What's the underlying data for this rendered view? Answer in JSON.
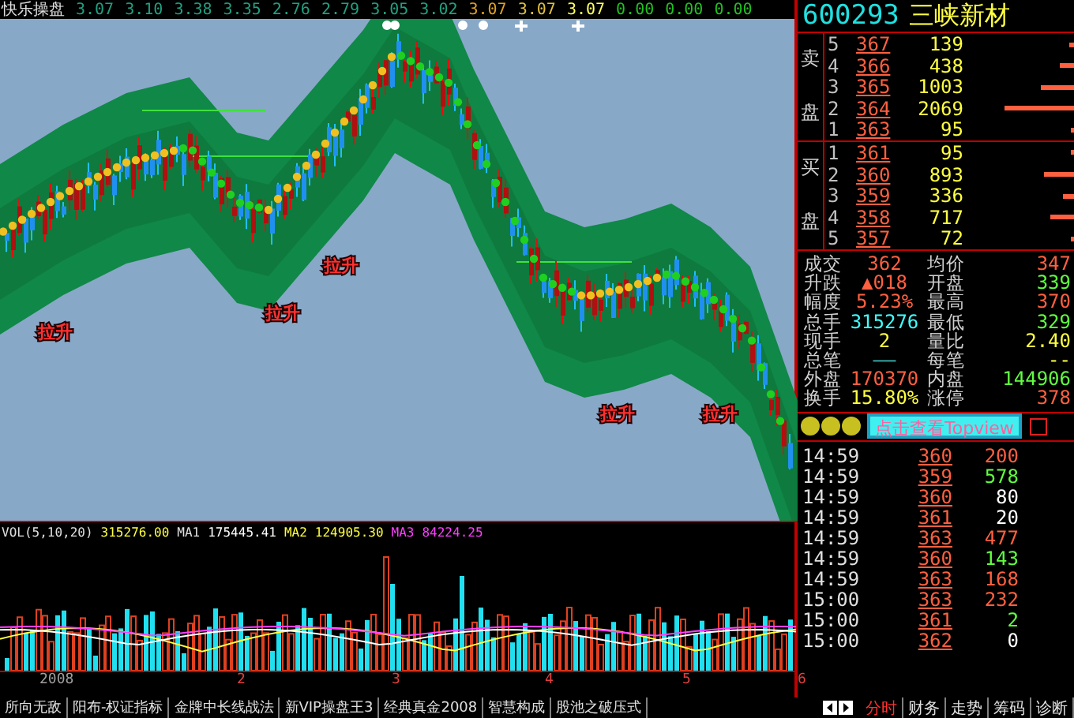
{
  "title": "快乐操盘",
  "quote_strip": [
    {
      "text": "3.07",
      "color": "#20a080"
    },
    {
      "text": "3.10",
      "color": "#20a080"
    },
    {
      "text": "3.38",
      "color": "#20a080"
    },
    {
      "text": "3.35",
      "color": "#20a080"
    },
    {
      "text": "2.76",
      "color": "#20a080"
    },
    {
      "text": "2.79",
      "color": "#20a080"
    },
    {
      "text": "3.05",
      "color": "#20a080"
    },
    {
      "text": "3.02",
      "color": "#20a080"
    },
    {
      "text": "3.07",
      "color": "#e0a020"
    },
    {
      "text": "3.07",
      "color": "#e0c040"
    },
    {
      "text": "3.07",
      "color": "#ffff60"
    },
    {
      "text": "0.00",
      "color": "#20c020"
    },
    {
      "text": "0.00",
      "color": "#20c020"
    },
    {
      "text": "0.00",
      "color": "#20c020"
    }
  ],
  "chart": {
    "annotations": [
      "拉升",
      "拉升",
      "拉升",
      "拉升",
      "拉升"
    ]
  },
  "volume_legend": [
    {
      "text": "VOL(5,10,20)",
      "color": "#e0e0e0"
    },
    {
      "text": "315276.00",
      "color": "#ffff40"
    },
    {
      "text": "MA1",
      "color": "#e0e0e0"
    },
    {
      "text": "175445.41",
      "color": "#ffffff"
    },
    {
      "text": "MA2",
      "color": "#ffff40"
    },
    {
      "text": "124905.30",
      "color": "#ffff40"
    },
    {
      "text": "MA3",
      "color": "#ff40ff"
    },
    {
      "text": "84224.25",
      "color": "#ff40ff"
    }
  ],
  "x_axis": [
    "2008",
    "2",
    "3",
    "4",
    "5",
    "6"
  ],
  "indicator_tabs": [
    {
      "label": "所向无敌",
      "selected": false
    },
    {
      "label": "阳布-权证指标",
      "selected": false
    },
    {
      "label": "金牌中长线战法",
      "selected": false
    },
    {
      "label": "新VIP操盘王3",
      "selected": false
    },
    {
      "label": "经典真金2008",
      "selected": false
    },
    {
      "label": "智慧构成",
      "selected": false
    },
    {
      "label": "股池之破压式",
      "selected": false
    }
  ],
  "view_tabs": [
    {
      "label": "分时",
      "selected": true
    },
    {
      "label": "财务",
      "selected": false
    },
    {
      "label": "走势",
      "selected": false
    },
    {
      "label": "筹码",
      "selected": false
    },
    {
      "label": "诊断",
      "selected": false
    }
  ],
  "quote": {
    "code": "600293",
    "name": "三峡新材",
    "sell_label": [
      "卖",
      "盘"
    ],
    "sell": [
      {
        "level": "5",
        "price": "367",
        "volume": "139"
      },
      {
        "level": "4",
        "price": "366",
        "volume": "438"
      },
      {
        "level": "3",
        "price": "365",
        "volume": "1003"
      },
      {
        "level": "2",
        "price": "364",
        "volume": "2069"
      },
      {
        "level": "1",
        "price": "363",
        "volume": "95"
      }
    ],
    "buy_label": [
      "买",
      "盘"
    ],
    "buy": [
      {
        "level": "1",
        "price": "361",
        "volume": "95"
      },
      {
        "level": "2",
        "price": "360",
        "volume": "893"
      },
      {
        "level": "3",
        "price": "359",
        "volume": "336"
      },
      {
        "level": "4",
        "price": "358",
        "volume": "717"
      },
      {
        "level": "5",
        "price": "357",
        "volume": "72"
      }
    ],
    "stats": [
      {
        "label": "成交",
        "value": "362",
        "color": "#ff6040"
      },
      {
        "label": "均价",
        "value": "347",
        "color": "#ff6040"
      },
      {
        "label": "升跌",
        "value": "▲018",
        "color": "#ff6040"
      },
      {
        "label": "开盘",
        "value": "339",
        "color": "#60ff40"
      },
      {
        "label": "幅度",
        "value": "5.23%",
        "color": "#ff6040"
      },
      {
        "label": "最高",
        "value": "370",
        "color": "#ff6040"
      },
      {
        "label": "总手",
        "value": "315276",
        "color": "#40ffff"
      },
      {
        "label": "最低",
        "value": "329",
        "color": "#60ff40"
      },
      {
        "label": "现手",
        "value": "2",
        "color": "#ffff40"
      },
      {
        "label": "量比",
        "value": "2.40",
        "color": "#ffff40"
      },
      {
        "label": "总笔",
        "value": "——",
        "color": "#40c0c0"
      },
      {
        "label": "每笔",
        "value": "--",
        "color": "#ffff40"
      },
      {
        "label": "外盘",
        "value": "170370",
        "color": "#ff6040"
      },
      {
        "label": "内盘",
        "value": "144906",
        "color": "#60ff40"
      },
      {
        "label": "换手",
        "value": "15.80%",
        "color": "#ffff40"
      },
      {
        "label": "涨停",
        "value": "378",
        "color": "#ff6040"
      }
    ],
    "topview_button": "点击查看Topview",
    "ticks": [
      {
        "time": "14:59",
        "price": "360",
        "volume": "200",
        "color": "#ff6040"
      },
      {
        "time": "14:59",
        "price": "359",
        "volume": "578",
        "color": "#60ff40"
      },
      {
        "time": "14:59",
        "price": "360",
        "volume": "80",
        "color": "#ffffff"
      },
      {
        "time": "14:59",
        "price": "361",
        "volume": "20",
        "color": "#ffffff"
      },
      {
        "time": "14:59",
        "price": "363",
        "volume": "477",
        "color": "#ff6040"
      },
      {
        "time": "14:59",
        "price": "360",
        "volume": "143",
        "color": "#60ff40"
      },
      {
        "time": "14:59",
        "price": "363",
        "volume": "168",
        "color": "#ff6040"
      },
      {
        "time": "15:00",
        "price": "363",
        "volume": "232",
        "color": "#ff6040"
      },
      {
        "time": "15:00",
        "price": "361",
        "volume": "2",
        "color": "#60ff40"
      },
      {
        "time": "15:00",
        "price": "362",
        "volume": "0",
        "color": "#ffffff"
      }
    ]
  }
}
